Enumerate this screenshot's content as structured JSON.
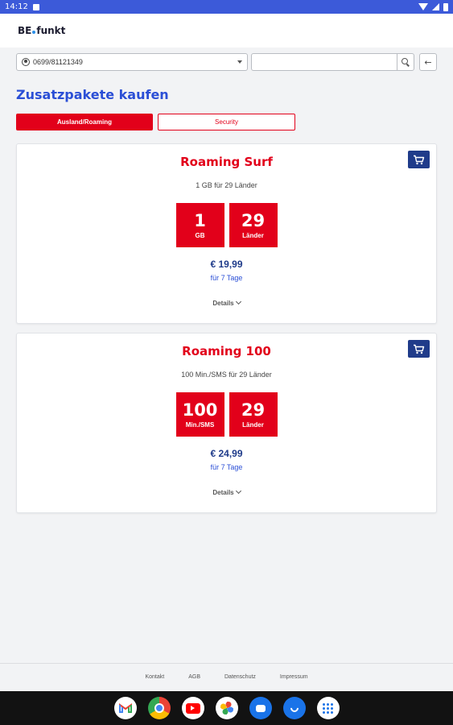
{
  "status_bar": {
    "time": "14:12"
  },
  "header": {
    "logo_left": "BE",
    "logo_right": "funkt"
  },
  "search": {
    "msisdn": "0699/81121349",
    "query": "",
    "back_label": "←"
  },
  "page": {
    "title": "Zusatzpakete kaufen"
  },
  "tabs": [
    {
      "label": "Ausland/Roaming",
      "active": true
    },
    {
      "label": "Security",
      "active": false
    }
  ],
  "packages": [
    {
      "title": "Roaming Surf",
      "subtitle": "1 GB für 29 Länder",
      "box1_big": "1",
      "box1_small": "GB",
      "box2_big": "29",
      "box2_small": "Länder",
      "price": "€ 19,99",
      "period": "für 7 Tage",
      "details_label": "Details"
    },
    {
      "title": "Roaming 100",
      "subtitle": "100 Min./SMS für 29 Länder",
      "box1_big": "100",
      "box1_small": "Min./SMS",
      "box2_big": "29",
      "box2_small": "Länder",
      "price": "€ 24,99",
      "period": "für 7 Tage",
      "details_label": "Details"
    }
  ],
  "footer": {
    "links": [
      "Kontakt",
      "AGB",
      "Datenschutz",
      "Impressum"
    ]
  },
  "colors": {
    "brand_red": "#e2001a",
    "brand_blue": "#2b4fd6",
    "navy": "#1f3b8a"
  },
  "nav_apps": [
    "gmail-icon",
    "chrome-icon",
    "youtube-icon",
    "photos-icon",
    "messages-icon",
    "phone-icon",
    "app-drawer-icon"
  ]
}
